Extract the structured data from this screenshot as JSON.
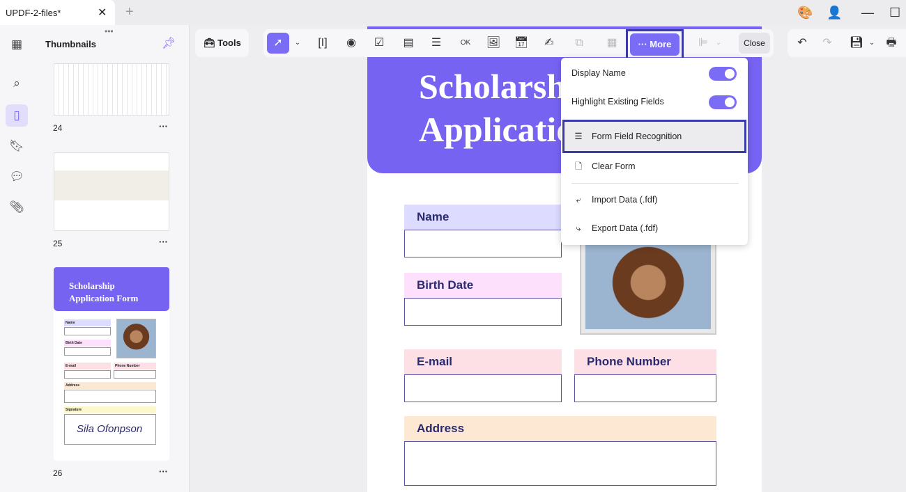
{
  "tab": {
    "title": "UPDF-2-files*"
  },
  "sidebar": {
    "title": "Thumbnails",
    "pages": [
      {
        "num": "24"
      },
      {
        "num": "25"
      },
      {
        "num": "26"
      }
    ]
  },
  "thumb26": {
    "title1": "Scholarship",
    "title2": "Application Form",
    "fields": [
      "Name",
      "Birth Date",
      "E-mail",
      "Phone Number",
      "Address",
      "Signature"
    ],
    "signature": "Sila Ofonpson"
  },
  "toolbar": {
    "tools": "Tools",
    "more": "More",
    "close": "Close"
  },
  "menu": {
    "display_name": "Display Name",
    "highlight": "Highlight Existing Fields",
    "recognition": "Form Field Recognition",
    "clear": "Clear Form",
    "import": "Import Data (.fdf)",
    "export": "Export Data (.fdf)",
    "display_name_on": true,
    "highlight_on": true
  },
  "document": {
    "title1": "Scholarsh",
    "title2": "Applicatio",
    "name": "Name",
    "birth": "Birth Date",
    "email": "E-mail",
    "phone": "Phone Number",
    "address": "Address"
  },
  "colors": {
    "accent": "#7b6cf6",
    "highlight_border": "#3a3aa8"
  }
}
